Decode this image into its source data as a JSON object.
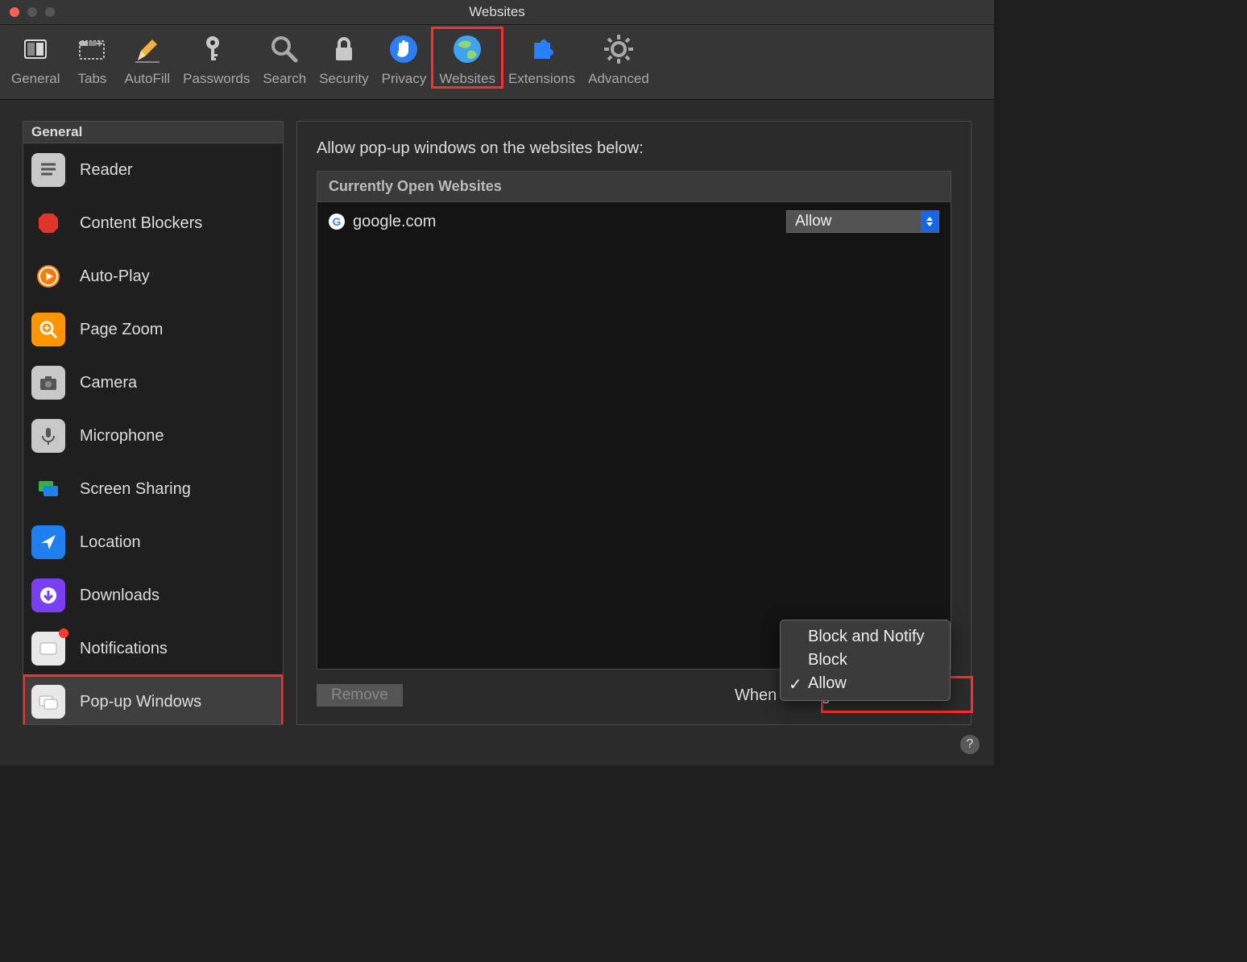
{
  "window_title": "Websites",
  "toolbar": [
    {
      "name": "general",
      "label": "General"
    },
    {
      "name": "tabs",
      "label": "Tabs"
    },
    {
      "name": "autofill",
      "label": "AutoFill"
    },
    {
      "name": "passwords",
      "label": "Passwords"
    },
    {
      "name": "search",
      "label": "Search"
    },
    {
      "name": "security",
      "label": "Security"
    },
    {
      "name": "privacy",
      "label": "Privacy"
    },
    {
      "name": "websites",
      "label": "Websites",
      "selected": true
    },
    {
      "name": "extensions",
      "label": "Extensions"
    },
    {
      "name": "advanced",
      "label": "Advanced"
    }
  ],
  "sidebar": {
    "header": "General",
    "items": [
      {
        "name": "reader",
        "label": "Reader"
      },
      {
        "name": "content-blockers",
        "label": "Content Blockers"
      },
      {
        "name": "auto-play",
        "label": "Auto-Play"
      },
      {
        "name": "page-zoom",
        "label": "Page Zoom"
      },
      {
        "name": "camera",
        "label": "Camera"
      },
      {
        "name": "microphone",
        "label": "Microphone"
      },
      {
        "name": "screen-sharing",
        "label": "Screen Sharing"
      },
      {
        "name": "location",
        "label": "Location"
      },
      {
        "name": "downloads",
        "label": "Downloads"
      },
      {
        "name": "notifications",
        "label": "Notifications",
        "badge": true
      },
      {
        "name": "pop-up-windows",
        "label": "Pop-up Windows",
        "selected": true,
        "highlighted": true
      }
    ]
  },
  "main": {
    "heading": "Allow pop-up windows on the websites below:",
    "list_header": "Currently Open Websites",
    "rows": [
      {
        "site": "google.com",
        "value": "Allow"
      }
    ],
    "remove_label": "Remove",
    "other_label": "When visiting other websites:",
    "other_value": "Allow",
    "menu": [
      "Block and Notify",
      "Block",
      "Allow"
    ],
    "menu_selected": "Allow"
  }
}
